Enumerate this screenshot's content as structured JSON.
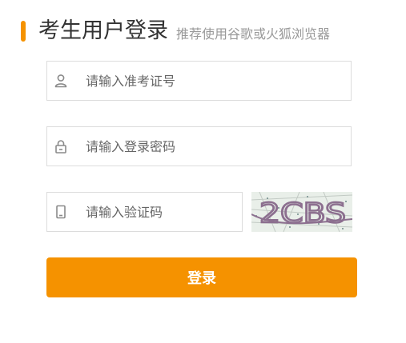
{
  "header": {
    "title": "考生用户登录",
    "subtitle": "推荐使用谷歌或火狐浏览器",
    "accent_color": "#f59200"
  },
  "form": {
    "ticket_field": {
      "placeholder": "请输入准考证号",
      "value": "",
      "icon": "user-icon"
    },
    "password_field": {
      "placeholder": "请输入登录密码",
      "value": "",
      "icon": "lock-icon"
    },
    "captcha_field": {
      "placeholder": "请输入验证码",
      "value": "",
      "icon": "phone-icon"
    },
    "captcha_image": {
      "text": "2CBS"
    },
    "login_button": {
      "label": "登录",
      "color": "#f59200"
    }
  }
}
